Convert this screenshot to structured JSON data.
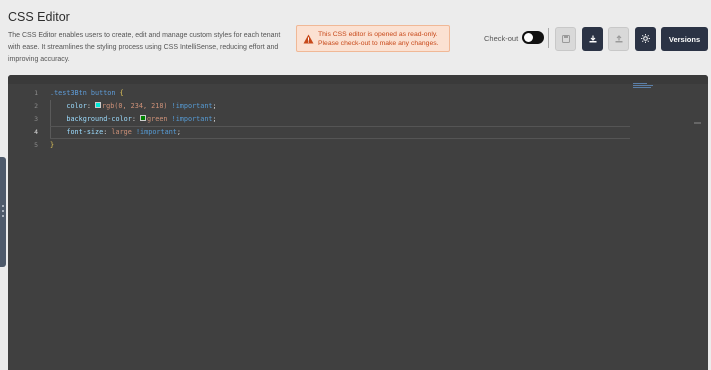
{
  "header": {
    "title": "CSS Editor",
    "description": "The CSS Editor enables users to create, edit and manage custom styles for each tenant with ease. It streamlines the styling process using CSS IntelliSense, reducing effort and improving accuracy."
  },
  "alert": {
    "line1": "This CSS editor is opened as read-only.",
    "line2": "Please check-out to make any changes.",
    "icon": "warning-icon",
    "color": "#c7491a"
  },
  "toolbar": {
    "checkout_label": "Check-out",
    "checkout_on": false,
    "buttons": [
      {
        "icon": "save-icon",
        "enabled": false
      },
      {
        "icon": "download-icon",
        "enabled": true
      },
      {
        "icon": "upload-icon",
        "enabled": false
      },
      {
        "icon": "sun-icon",
        "enabled": true
      }
    ],
    "versions_label": "Versions",
    "accent": "#2b3345"
  },
  "editor": {
    "line_numbers": [
      "1",
      "2",
      "3",
      "4",
      "5"
    ],
    "active_line": 4,
    "lines": {
      "l1": {
        "selector": ".test3Btn button",
        "open": " {"
      },
      "l2": {
        "prop": "color",
        "colon": ": ",
        "value": "rgb(0, 234, 218)",
        "imp": " !important",
        "semi": ";",
        "swatch": "#00ead9"
      },
      "l3": {
        "prop": "background-color",
        "colon": ": ",
        "value": "green",
        "imp": " !important",
        "semi": ";",
        "swatch": "#008000"
      },
      "l4": {
        "prop": "font-size",
        "colon": ": ",
        "value": "large",
        "imp": " !important",
        "semi": ";"
      },
      "l5": {
        "close": "}"
      }
    }
  }
}
